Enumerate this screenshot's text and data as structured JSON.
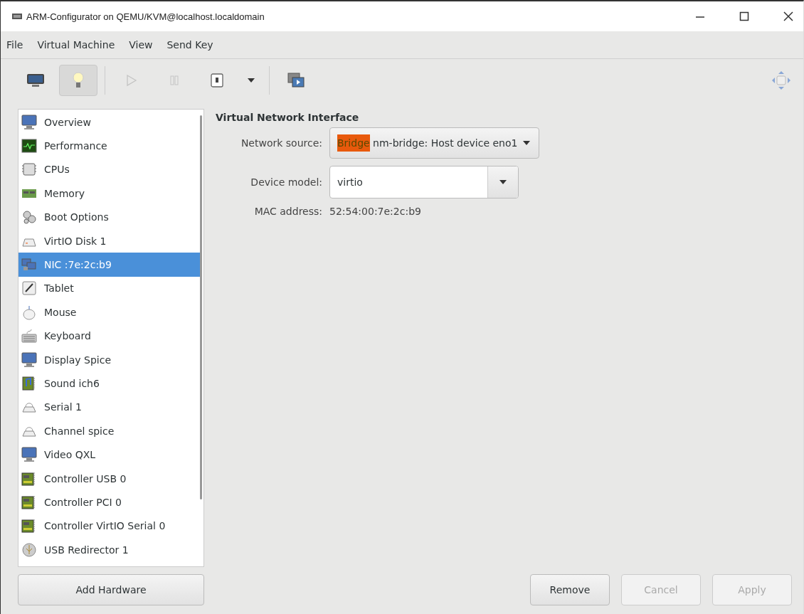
{
  "window": {
    "title": "ARM-Configurator on QEMU/KVM@localhost.localdomain"
  },
  "menu": [
    "File",
    "Virtual Machine",
    "View",
    "Send Key"
  ],
  "toolbar": [
    {
      "kind": "console",
      "selected": false,
      "disabled": false
    },
    {
      "kind": "details",
      "selected": true,
      "disabled": false
    },
    {
      "kind": "run",
      "selected": false,
      "disabled": true
    },
    {
      "kind": "pause",
      "selected": false,
      "disabled": true
    },
    {
      "kind": "shutdown",
      "selected": false,
      "disabled": false
    },
    {
      "kind": "dropdown",
      "selected": false,
      "disabled": false
    },
    {
      "kind": "fullscreen",
      "selected": false,
      "disabled": false
    }
  ],
  "sidebar": {
    "items": [
      {
        "label": "Overview",
        "kind": "overview",
        "selected": false
      },
      {
        "label": "Performance",
        "kind": "performance",
        "selected": false
      },
      {
        "label": "CPUs",
        "kind": "cpu",
        "selected": false
      },
      {
        "label": "Memory",
        "kind": "memory",
        "selected": false
      },
      {
        "label": "Boot Options",
        "kind": "boot",
        "selected": false
      },
      {
        "label": "VirtIO Disk 1",
        "kind": "disk",
        "selected": false
      },
      {
        "label": "NIC :7e:2c:b9",
        "kind": "nic",
        "selected": true
      },
      {
        "label": "Tablet",
        "kind": "tablet",
        "selected": false
      },
      {
        "label": "Mouse",
        "kind": "mouse",
        "selected": false
      },
      {
        "label": "Keyboard",
        "kind": "keyboard",
        "selected": false
      },
      {
        "label": "Display Spice",
        "kind": "display",
        "selected": false
      },
      {
        "label": "Sound ich6",
        "kind": "sound",
        "selected": false
      },
      {
        "label": "Serial 1",
        "kind": "serial",
        "selected": false
      },
      {
        "label": "Channel spice",
        "kind": "serial",
        "selected": false
      },
      {
        "label": "Video QXL",
        "kind": "display",
        "selected": false
      },
      {
        "label": "Controller USB 0",
        "kind": "controller",
        "selected": false
      },
      {
        "label": "Controller PCI 0",
        "kind": "controller",
        "selected": false
      },
      {
        "label": "Controller VirtIO Serial 0",
        "kind": "controller",
        "selected": false
      },
      {
        "label": "USB Redirector 1",
        "kind": "usb",
        "selected": false
      }
    ],
    "add_button": "Add Hardware"
  },
  "details": {
    "heading": "Virtual Network Interface",
    "network_source": {
      "label": "Network source:",
      "value_parts": [
        {
          "text": "Bridge",
          "highlighted": true
        },
        {
          "text": " nm-bridge: Host device eno1",
          "highlighted": false
        }
      ]
    },
    "device_model": {
      "label": "Device model:",
      "value": "virtio"
    },
    "mac_address": {
      "label": "MAC address:",
      "value": "52:54:00:7e:2c:b9"
    }
  },
  "buttons": [
    {
      "label": "Remove",
      "disabled": false
    },
    {
      "label": "Cancel",
      "disabled": true
    },
    {
      "label": "Apply",
      "disabled": true
    }
  ]
}
